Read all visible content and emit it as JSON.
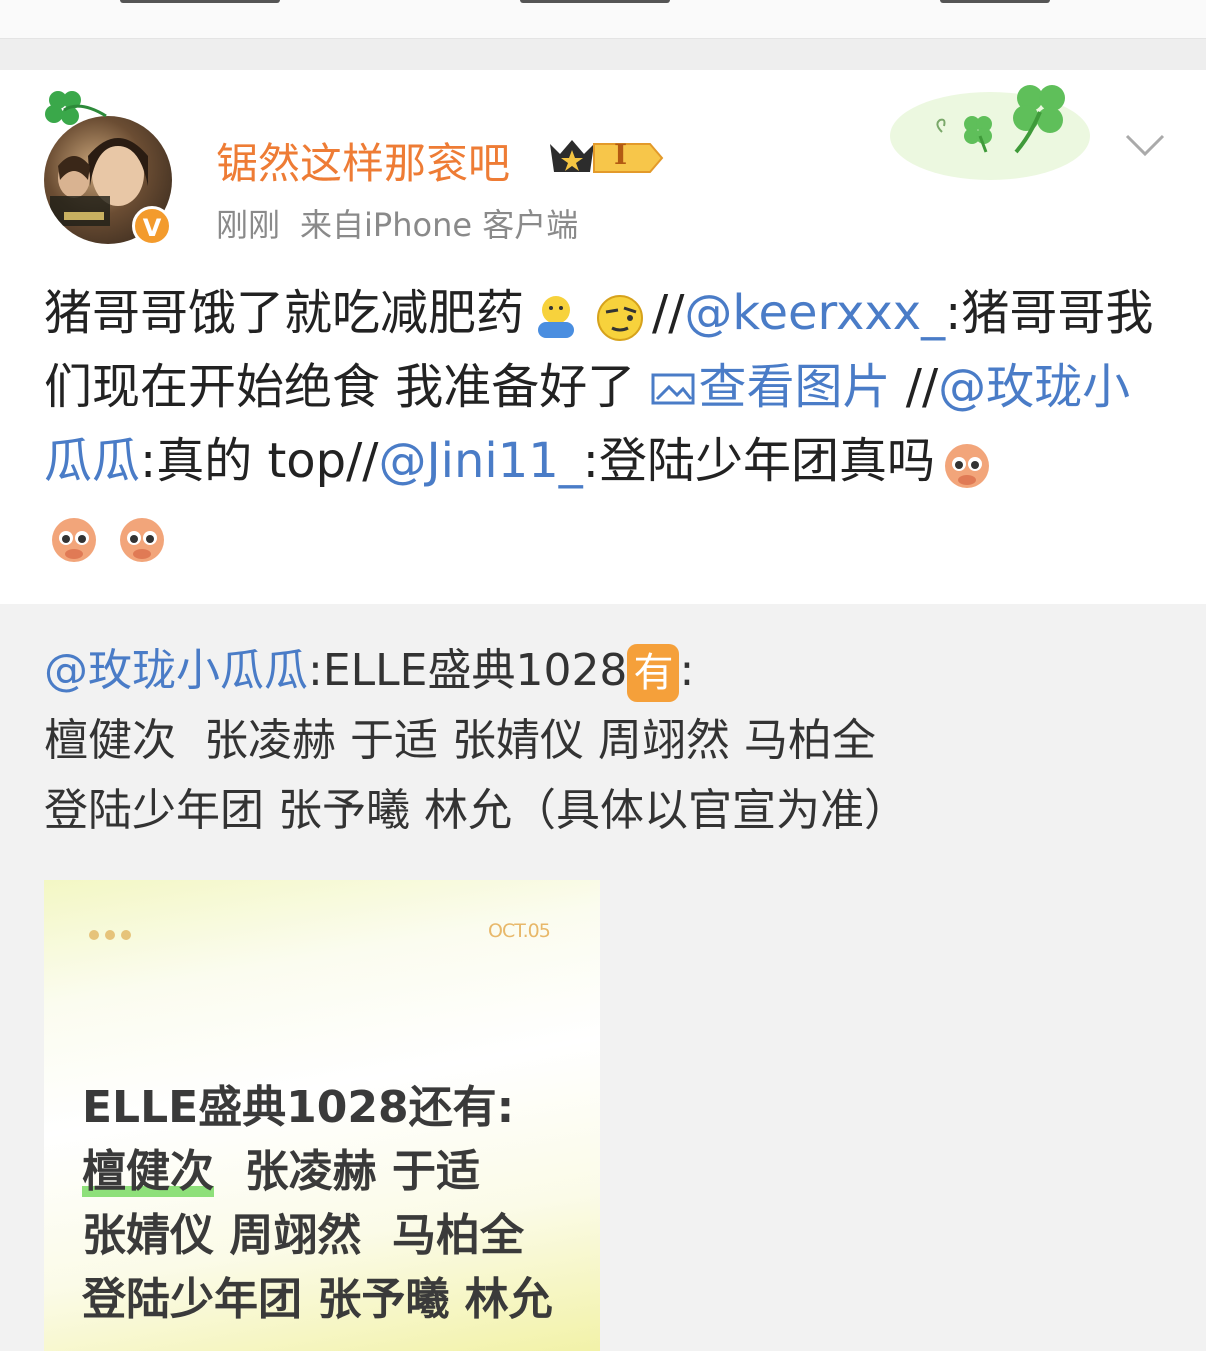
{
  "post": {
    "username": "锯然这样那衮吧",
    "vip_level": "I",
    "time": "刚刚",
    "source": "来自iPhone 客户端",
    "verify_badge": "V",
    "text": {
      "part1": "猪哥哥饿了就吃减肥药",
      "sep1": "//",
      "mention1": "@keerxxx_",
      "part2": ":猪哥哥我们现在开始绝食 我准备好了 ",
      "view_image": "查看图片",
      "sep2": " //",
      "mention2": "@玫珑小瓜瓜",
      "part3": ":真的 top//",
      "mention3": "@Jini11_",
      "part4": ":登陆少年团真吗"
    }
  },
  "repost": {
    "mention": "@玫珑小瓜瓜",
    "lead": ":ELLE盛典1028",
    "badge": "有",
    "colon": ":",
    "line2": "檀健次  张凌赫 于适 张婧仪 周翊然 马柏全",
    "line3": "登陆少年团 张予曦 林允（具体以官宣为准）"
  },
  "image": {
    "date": "OCT.05",
    "line1": "ELLE盛典1028还有:",
    "line2a": "檀健次",
    "line2b": "  张凌赫 于适",
    "line3": "张婧仪 周翊然  马柏全",
    "line4": "登陆少年团 张予曦 林允"
  },
  "colors": {
    "username": "#ee7c35",
    "link": "#4a7cc7",
    "verify": "#f39b2d",
    "badge": "#f5a03a"
  },
  "icons": [
    "clover-icon",
    "vip-crown-icon",
    "chevron-down-icon",
    "verified-icon",
    "image-icon",
    "emoji-icon"
  ]
}
